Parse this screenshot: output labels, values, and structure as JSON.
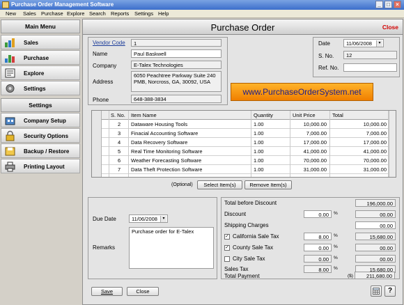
{
  "window": {
    "title": "Purchase Order Management Software"
  },
  "menu": [
    "New",
    "Sales",
    "Purchase",
    "Explore",
    "Search",
    "Reports",
    "Settings",
    "Help"
  ],
  "sidebar": {
    "main_menu_header": "Main Menu",
    "main_items": [
      "Sales",
      "Purchase",
      "Explore",
      "Settings"
    ],
    "settings_header": "Settings",
    "settings_items": [
      "Company Setup",
      "Security Options",
      "Backup / Restore",
      "Printing Layout"
    ]
  },
  "page": {
    "title": "Purchase Order",
    "close_label": "Close"
  },
  "vendor": {
    "vendor_code_label": "Vendor Code",
    "vendor_code": "1",
    "name_label": "Name",
    "name": "Paul Baskwell",
    "company_label": "Company",
    "company": "E-Talex Technologies",
    "address_label": "Address",
    "address": "6050 Peachtree Parkway Suite 240 PMB, Norcross, GA, 30092, USA",
    "phone_label": "Phone",
    "phone": "648-388-3834"
  },
  "order_info": {
    "date_label": "Date",
    "date": "11/06/2008",
    "sno_label": "S. No.",
    "sno": "12",
    "ref_label": "Ref. No.",
    "ref": ""
  },
  "banner_text": "www.PurchaseOrderSystem.net",
  "items_table": {
    "columns": [
      "S. No.",
      "Item Name",
      "Quantity",
      "Unit Price",
      "Total"
    ],
    "rows": [
      [
        "2",
        "Dataware Housing Tools",
        "1.00",
        "10,000.00",
        "10,000.00"
      ],
      [
        "3",
        "Finacial Accounting Software",
        "1.00",
        "7,000.00",
        "7,000.00"
      ],
      [
        "4",
        "Data Recovery Software",
        "1.00",
        "17,000.00",
        "17,000.00"
      ],
      [
        "5",
        "Real Time Monitoring Software",
        "1.00",
        "41,000.00",
        "41,000.00"
      ],
      [
        "6",
        "Weather Forecasting Software",
        "1.00",
        "70,000.00",
        "70,000.00"
      ],
      [
        "7",
        "Data Theft Protection Software",
        "1.00",
        "31,000.00",
        "31,000.00"
      ],
      [
        "8",
        "",
        "",
        "",
        ""
      ]
    ]
  },
  "table_actions": {
    "optional": "(Optional)",
    "select": "Select Item(s)",
    "remove": "Remove Item(s)"
  },
  "due": {
    "due_date_label": "Due Date",
    "due_date": "11/06/2008",
    "remarks_label": "Remarks",
    "remarks": "Purchase order for E-Talex"
  },
  "totals": {
    "total_before_discount_label": "Total before Discount",
    "total_before_discount": "196,000.00",
    "discount_label": "Discount",
    "discount_pct": "0.00",
    "discount_amt": "00.00",
    "shipping_label": "Shipping Charges",
    "shipping": "00.00",
    "ca_tax_label": "California Sale Tax",
    "ca_tax_pct": "8.00",
    "ca_tax_amt": "15,680.00",
    "county_tax_label": "County Sale Tax",
    "county_tax_pct": "0.00",
    "county_tax_amt": "00.00",
    "city_tax_label": "City Sale Tax",
    "city_tax_pct": "0.00",
    "city_tax_amt": "00.00",
    "sales_tax_label": "Sales Tax",
    "sales_tax_pct": "8.00",
    "sales_tax_amt": "15,680.00",
    "total_payment_label": "Total Payment",
    "currency": "($)",
    "total_payment": "211,680.00",
    "pct_symbol": "%"
  },
  "footer": {
    "save": "Save",
    "close": "Close",
    "help": "?"
  }
}
